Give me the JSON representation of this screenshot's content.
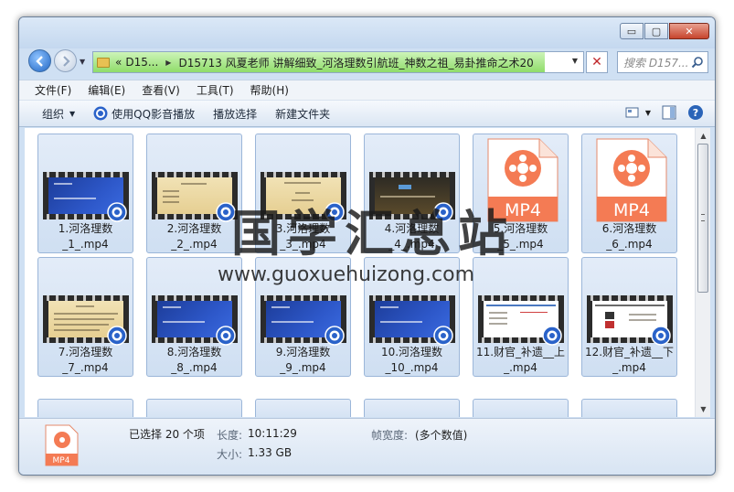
{
  "window": {
    "controls": {
      "minimize": "▭",
      "maximize": "▢",
      "close": "✕"
    }
  },
  "nav": {
    "back_icon": "back-arrow-icon",
    "forward_icon": "forward-arrow-icon",
    "address": {
      "prefix": "«",
      "crumb1": "D15...",
      "crumb2": "D15713 风夏老师 讲解细致_河洛理数引航班_神数之祖_易卦推命之术20"
    },
    "search_placeholder": "搜索 D157..."
  },
  "menu": [
    "文件(F)",
    "编辑(E)",
    "查看(V)",
    "工具(T)",
    "帮助(H)"
  ],
  "toolbar": {
    "organize": "组织",
    "qq_play": "使用QQ影音播放",
    "play_selection": "播放选择",
    "new_folder": "新建文件夹"
  },
  "files": [
    {
      "name": "1.河洛理数_1_.mp4",
      "line1": "1.河洛理数",
      "line2": "_1_.mp4",
      "thumb": "blue"
    },
    {
      "name": "2.河洛理数_2_.mp4",
      "line1": "2.河洛理数",
      "line2": "_2_.mp4",
      "thumb": "beige"
    },
    {
      "name": "3.河洛理数_3_.mp4",
      "line1": "3.河洛理数",
      "line2": "_3_.mp4",
      "thumb": "beige"
    },
    {
      "name": "4.河洛理数_4_.mp4",
      "line1": "4.河洛理数",
      "line2": "_4_.mp4",
      "thumb": "dark"
    },
    {
      "name": "5.河洛理数_5_.mp4",
      "line1": "5.河洛理数",
      "line2": "_5_.mp4",
      "thumb": "mp4"
    },
    {
      "name": "6.河洛理数_6_.mp4",
      "line1": "6.河洛理数",
      "line2": "_6_.mp4",
      "thumb": "mp4"
    },
    {
      "name": "7.河洛理数_7_.mp4",
      "line1": "7.河洛理数",
      "line2": "_7_.mp4",
      "thumb": "beige"
    },
    {
      "name": "8.河洛理数_8_.mp4",
      "line1": "8.河洛理数",
      "line2": "_8_.mp4",
      "thumb": "blue"
    },
    {
      "name": "9.河洛理数_9_.mp4",
      "line1": "9.河洛理数",
      "line2": "_9_.mp4",
      "thumb": "blue"
    },
    {
      "name": "10.河洛理数_10_.mp4",
      "line1": "10.河洛理数",
      "line2": "_10_.mp4",
      "thumb": "blue"
    },
    {
      "name": "11.财官_补遗__上_.mp4",
      "line1": "11.财官_补遗__上",
      "line2": "_.mp4",
      "thumb": "doc"
    },
    {
      "name": "12.财官_补遗__下_.mp4",
      "line1": "12.财官_补遗__下",
      "line2": "_.mp4",
      "thumb": "doc"
    }
  ],
  "mp4_label": "MP4",
  "status": {
    "selected": "已选择 20 个项",
    "length_label": "长度:",
    "length_value": "10:11:29",
    "size_label": "大小:",
    "size_value": "1.33 GB",
    "framewidth_label": "帧宽度:",
    "framewidth_value": "(多个数值)"
  },
  "watermark": {
    "title": "国学汇总站",
    "url": "www.guoxuehuizong.com"
  },
  "colors": {
    "accent": "#2166c4",
    "address_progress": "#8fdc6a",
    "mp4_orange": "#f47b54",
    "chrome": "#cfe0f3"
  }
}
